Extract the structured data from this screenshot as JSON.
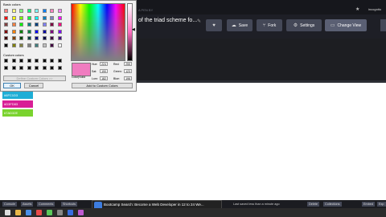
{
  "window": {
    "pen_title": "of the triad scheme fo...",
    "username": "incognito"
  },
  "header_buttons": [
    {
      "label": "",
      "icon": "heart-icon"
    },
    {
      "label": "Save",
      "icon": "cloud-icon"
    },
    {
      "label": "Fork",
      "icon": "fork-icon"
    },
    {
      "label": "Settings",
      "icon": "gear-icon"
    },
    {
      "label": "Change View",
      "icon": "layout-icon"
    }
  ],
  "result_swatches": [
    {
      "label": "#6FC1D3",
      "color": "#1eaed6"
    },
    {
      "label": "#D3FD83",
      "color": "#d81f96"
    },
    {
      "label": "#7AD32E",
      "color": "#7ad32e"
    }
  ],
  "color_dialog": {
    "basic_colors_label": "Basic colors",
    "custom_colors_label": "Custom colors",
    "define_button": "Define Custom Colors >>",
    "ok": "OK",
    "cancel": "Cancel",
    "color_solid_label": "Color|Solid",
    "add_button": "Add to Custom Colors",
    "fields": {
      "hue_label": "Hue:",
      "hue": "224",
      "sat_label": "Sat:",
      "sat": "190",
      "lum_label": "Lum:",
      "lum": "182",
      "red_label": "Red:",
      "red": "255",
      "green_label": "Green:",
      "green": "123",
      "blue_label": "Blue:",
      "blue": "196"
    },
    "basic_colors": [
      "#ff8080",
      "#ffff80",
      "#80ff80",
      "#00ff80",
      "#80ffff",
      "#0080ff",
      "#ff80c0",
      "#ff80ff",
      "#ff0000",
      "#ffff00",
      "#80ff00",
      "#00ff40",
      "#00ffff",
      "#0080c0",
      "#8080c0",
      "#ff00ff",
      "#804040",
      "#ff8040",
      "#00ff00",
      "#008080",
      "#004080",
      "#8080ff",
      "#800040",
      "#ff0080",
      "#800000",
      "#ff8000",
      "#008000",
      "#008040",
      "#0000ff",
      "#0000a0",
      "#800080",
      "#8000ff",
      "#400000",
      "#804000",
      "#004000",
      "#004040",
      "#000080",
      "#000040",
      "#400040",
      "#400080",
      "#000000",
      "#808000",
      "#808040",
      "#808080",
      "#408080",
      "#c0c0c0",
      "#400040",
      "#ffffff"
    ],
    "custom_colors": [
      "#000000",
      "#000000",
      "#000000",
      "#000000",
      "#000000",
      "#000000",
      "#000000",
      "#000000",
      "#000000",
      "#000000",
      "#000000",
      "#000000",
      "#000000",
      "#000000",
      "#000000",
      "#000000"
    ]
  },
  "bottom_bar": {
    "console": "Console",
    "assets": "Assets",
    "comments": "Comments",
    "shortcuts": "Shortcuts",
    "last_saved": "Last saved less than a minute ago",
    "delete": "Delete",
    "collections": "Collections",
    "embed": "Embed",
    "export": "Exp"
  },
  "notification": {
    "text": "Bootcamp Search: Become a Web Developer in 12 to 24 We..."
  },
  "taskbar_icons": [
    {
      "name": "start-icon",
      "color": "#dddddd"
    },
    {
      "name": "folder-icon",
      "color": "#e8b84a"
    },
    {
      "name": "browser-icon",
      "color": "#4a8fe8"
    },
    {
      "name": "chrome-icon",
      "color": "#e84a4a"
    },
    {
      "name": "app-icon",
      "color": "#5ac85a"
    },
    {
      "name": "app2-icon",
      "color": "#888888"
    },
    {
      "name": "app3-icon",
      "color": "#3a6ee0"
    },
    {
      "name": "app4-icon",
      "color": "#c05ad0"
    }
  ]
}
